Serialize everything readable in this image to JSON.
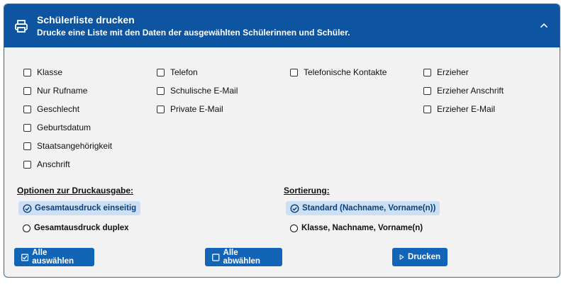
{
  "header": {
    "title": "Schülerliste drucken",
    "subtitle": "Drucke eine Liste mit den Daten der ausgewählten Schülerinnen und Schüler."
  },
  "columns": [
    [
      "Klasse",
      "Nur Rufname",
      "Geschlecht",
      "Geburtsdatum",
      "Staatsangehörigkeit",
      "Anschrift"
    ],
    [
      "Telefon",
      "Schulische E-Mail",
      "Private E-Mail"
    ],
    [
      "Telefonische Kontakte"
    ],
    [
      "Erzieher",
      "Erzieher Anschrift",
      "Erzieher E-Mail"
    ]
  ],
  "print_options": {
    "title": "Optionen zur Druckausgabe:",
    "options": [
      "Gesamtausdruck einseitig",
      "Gesamtausdruck duplex"
    ],
    "selected": "Gesamtausdruck einseitig"
  },
  "sorting": {
    "title": "Sortierung:",
    "options": [
      "Standard (Nachname, Vorname(n))",
      "Klasse, Nachname, Vorname(n)"
    ],
    "selected": "Standard (Nachname, Vorname(n))"
  },
  "buttons": {
    "select_all": "Alle auswählen",
    "deselect_all": "Alle abwählen",
    "print": "Drucken"
  },
  "colors": {
    "header_bg": "#0d55a0",
    "button_bg": "#1264b6",
    "selected_bg": "#cde0f3"
  },
  "icons": {
    "header": "printer-icon",
    "collapse": "chevron-up-icon",
    "select_all": "checkbox-checked-icon",
    "deselect_all": "checkbox-empty-icon",
    "print": "play-triangle-icon"
  }
}
